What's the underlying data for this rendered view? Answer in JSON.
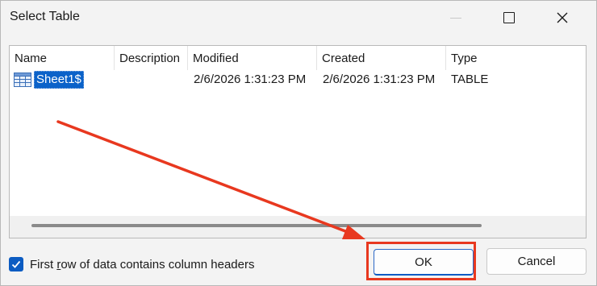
{
  "window": {
    "title": "Select Table"
  },
  "list": {
    "columns": [
      {
        "label": "Name"
      },
      {
        "label": "Description"
      },
      {
        "label": "Modified"
      },
      {
        "label": "Created"
      },
      {
        "label": "Type"
      }
    ],
    "rows": [
      {
        "name": "Sheet1$",
        "description": "",
        "modified": "2/6/2026 1:31:23 PM",
        "created": "2/6/2026 1:31:23 PM",
        "type": "TABLE",
        "selected": true,
        "icon": "table-icon"
      }
    ]
  },
  "options": {
    "first_row_headers_label_pre": "First ",
    "first_row_headers_label_accel": "r",
    "first_row_headers_label_post": "ow of data contains column headers",
    "first_row_headers_checked": true
  },
  "buttons": {
    "ok": "OK",
    "cancel": "Cancel"
  },
  "colors": {
    "selection": "#0b62c9",
    "annotation": "#e8381f",
    "checkbox": "#0c5cc2"
  }
}
